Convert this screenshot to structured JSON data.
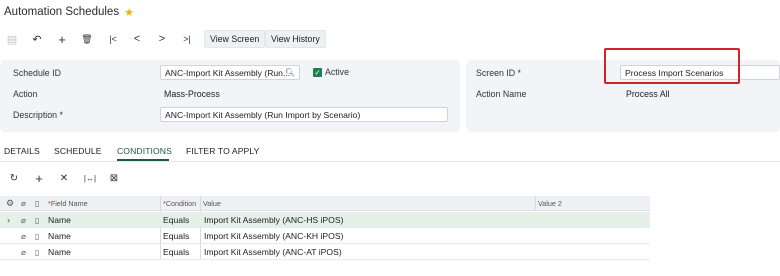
{
  "header": {
    "title": "Automation Schedules",
    "star": "★"
  },
  "toolbar": {
    "icons": {
      "save": "▤",
      "undo": "↶",
      "add": "+",
      "delete": "🗑",
      "first": "|<",
      "prev": "<",
      "next": ">",
      "last": ">|"
    },
    "view_screen": "View Screen",
    "view_history": "View History"
  },
  "form": {
    "schedule_id_label": "Schedule ID",
    "schedule_id_value": "ANC-Import Kit Assembly (Run...",
    "active_label": "Active",
    "active_checked": true,
    "action_label": "Action",
    "action_value": "Mass-Process",
    "description_label": "Description *",
    "description_value": "ANC-Import Kit Assembly (Run Import by Scenario)",
    "screen_id_label": "Screen ID *",
    "screen_id_value": "Process Import Scenarios",
    "action_name_label": "Action Name",
    "action_name_value": "Process All"
  },
  "tabs": [
    {
      "label": "DETAILS",
      "active": false
    },
    {
      "label": "SCHEDULE",
      "active": false
    },
    {
      "label": "CONDITIONS",
      "active": true
    },
    {
      "label": "FILTER TO APPLY",
      "active": false
    }
  ],
  "grid_toolbar": {
    "refresh": "↻",
    "add": "+",
    "delete": "✕",
    "fit": "|↔|",
    "export": "⊠"
  },
  "grid": {
    "columns": {
      "field_name": "Field Name",
      "condition": "Condition",
      "value": "Value",
      "value2": "Value 2"
    },
    "rows": [
      {
        "field_name": "Name",
        "condition": "Equals",
        "value": "Import Kit Assembly (ANC-HS iPOS)",
        "value2": "",
        "selected": true
      },
      {
        "field_name": "Name",
        "condition": "Equals",
        "value": "Import Kit Assembly (ANC-KH iPOS)",
        "value2": "",
        "selected": false
      },
      {
        "field_name": "Name",
        "condition": "Equals",
        "value": "Import Kit Assembly (ANC-AT iPOS)",
        "value2": "",
        "selected": false
      }
    ]
  },
  "colors": {
    "accent": "#1d5c3e",
    "highlight": "#d0232c",
    "star": "#f0b400"
  }
}
